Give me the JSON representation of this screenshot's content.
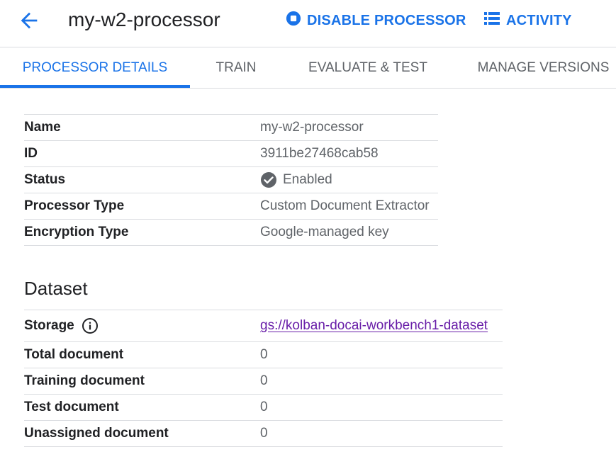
{
  "header": {
    "title": "my-w2-processor",
    "disable_label": "DISABLE PROCESSOR",
    "activity_label": "ACTIVITY",
    "icons": {
      "back": "arrow-back-icon",
      "disable": "stop-circle-icon",
      "activity": "list-icon"
    }
  },
  "tabs": [
    {
      "label": "PROCESSOR DETAILS",
      "active": true
    },
    {
      "label": "TRAIN"
    },
    {
      "label": "EVALUATE & TEST"
    },
    {
      "label": "MANAGE VERSIONS"
    }
  ],
  "details": [
    {
      "key": "Name",
      "value": "my-w2-processor"
    },
    {
      "key": "ID",
      "value": "3911be27468cab58"
    },
    {
      "key": "Status",
      "value": "Enabled"
    },
    {
      "key": "Processor Type",
      "value": "Custom Document Extractor"
    },
    {
      "key": "Encryption Type",
      "value": "Google-managed key"
    }
  ],
  "dataset": {
    "title": "Dataset",
    "rows": [
      {
        "key": "Storage",
        "value": "gs://kolban-docai-workbench1-dataset"
      },
      {
        "key": "Total document",
        "value": "0"
      },
      {
        "key": "Training document",
        "value": "0"
      },
      {
        "key": "Test document",
        "value": "0"
      },
      {
        "key": "Unassigned document",
        "value": "0"
      }
    ]
  },
  "colors": {
    "accent": "#1a73e8",
    "link": "#681da8",
    "text": "#202124",
    "muted": "#5f6368",
    "divider": "#dadce0"
  }
}
